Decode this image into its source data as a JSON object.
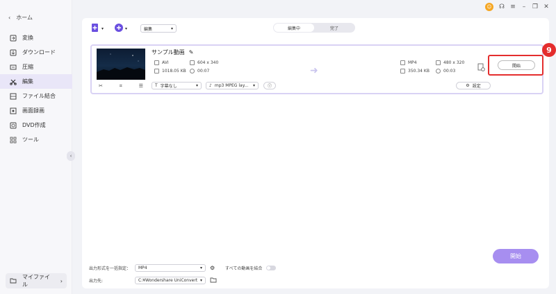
{
  "sidebar": {
    "home_label": "ホーム",
    "items": [
      {
        "label": "変換",
        "icon": "convert-icon"
      },
      {
        "label": "ダウンロード",
        "icon": "download-icon"
      },
      {
        "label": "圧縮",
        "icon": "compress-icon"
      },
      {
        "label": "編集",
        "icon": "edit-icon",
        "active": true
      },
      {
        "label": "ファイル結合",
        "icon": "merge-icon"
      },
      {
        "label": "画面録画",
        "icon": "screen-record-icon"
      },
      {
        "label": "DVD作成",
        "icon": "dvd-icon"
      },
      {
        "label": "ツール",
        "icon": "toolbox-icon"
      }
    ],
    "my_files_label": "マイファイル"
  },
  "toolbar": {
    "mode_select_value": "編集",
    "tabs": [
      "編集中",
      "完了"
    ]
  },
  "file_card": {
    "title": "サンプル動画",
    "source": {
      "format": "AVI",
      "resolution": "604 x 340",
      "size": "1018.05 KB",
      "duration": "00:07"
    },
    "output": {
      "format": "MP4",
      "resolution": "480 x 320",
      "size": "350.34 KB",
      "duration": "00:03"
    },
    "subtitle_value": "字幕なし",
    "audio_value": "mp3 MPEG lay...",
    "settings_label": "設定",
    "start_label": "開始",
    "callout_number": "9"
  },
  "bottom": {
    "output_format_label": "出力形式を一括指定：",
    "output_format_value": "MP4",
    "merge_label": "すべての動画を結合",
    "output_path_label": "出力先:",
    "output_path_value": "C:¥Wondershare UniConverter 1",
    "start_all_label": "開始"
  },
  "colors": {
    "accent": "#a78ef0",
    "callout": "#e42d2d",
    "avatar": "#f5a623"
  }
}
